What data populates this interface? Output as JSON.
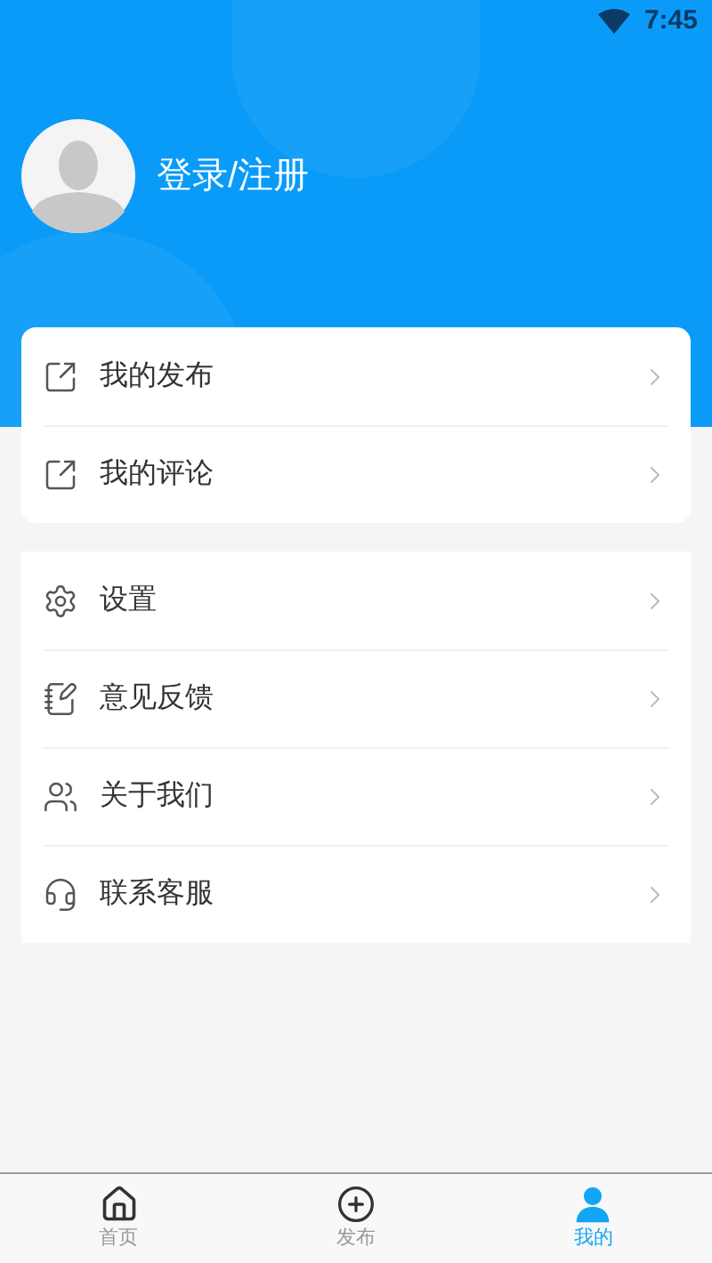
{
  "status_bar": {
    "time": "7:45"
  },
  "profile": {
    "login_label": "登录/注册"
  },
  "menu_groups": [
    {
      "items": [
        {
          "kind": "edit",
          "label": "我的发布"
        },
        {
          "kind": "edit",
          "label": "我的评论"
        }
      ]
    },
    {
      "items": [
        {
          "kind": "gear",
          "label": "设置"
        },
        {
          "kind": "note",
          "label": "意见反馈"
        },
        {
          "kind": "users",
          "label": "关于我们"
        },
        {
          "kind": "headset",
          "label": "联系客服"
        }
      ]
    }
  ],
  "tab_bar": [
    {
      "kind": "home",
      "label": "首页",
      "selected": false
    },
    {
      "kind": "plus",
      "label": "发布",
      "selected": false
    },
    {
      "kind": "user",
      "label": "我的",
      "selected": true
    }
  ]
}
